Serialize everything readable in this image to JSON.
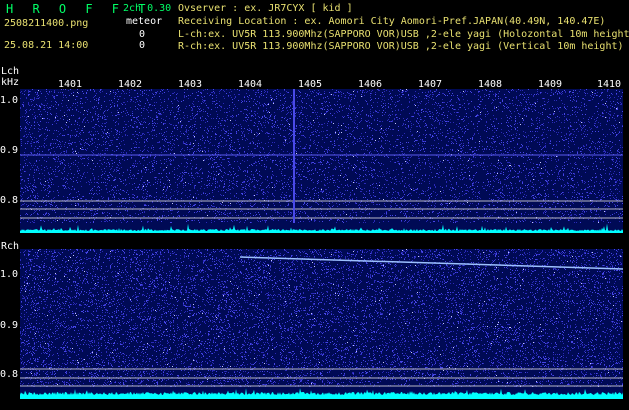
{
  "header": {
    "app_title": "H R O F F T",
    "filename": "2508211400.png",
    "datetime": "25.08.21 14:00",
    "mode": "2ch 0.30",
    "meteor_label": "meteor",
    "meteor_count_l": "0",
    "meteor_count_r": "0",
    "observer_line": "Ovserver           : ex. JR7CYX [ kid ]",
    "location_line": "Receiving Location : ex. Aomori City Aomori-Pref.JAPAN(40.49N, 140.47E)",
    "lch_line": "L-ch:ex. UV5R 113.900Mhz(SAPPORO VOR)USB ,2-ele yagi (Holozontal 10m height",
    "rch_line": "R-ch:ex. UV5R 113.900Mhz(SAPPORO VOR)USB ,2-ele yagi (Vertical 10m height)"
  },
  "time_axis": [
    "1401",
    "1402",
    "1403",
    "1404",
    "1405",
    "1406",
    "1407",
    "1408",
    "1409",
    "1410"
  ],
  "left_channel": {
    "tag": "Lch",
    "unit": "kHz",
    "freq_labels": [
      "1.0",
      "0.9",
      "0.8"
    ]
  },
  "right_channel": {
    "tag": "Rch",
    "freq_labels": [
      "1.0",
      "0.9",
      "0.8"
    ]
  },
  "colors": {
    "background": "#000000",
    "spectrum_bg": "#000a55",
    "noise": "#3a3ad8",
    "trace": "#00ffff",
    "white": "#ffffff",
    "status_green": "#00ff66",
    "filename_yellow": "#e8e070"
  }
}
